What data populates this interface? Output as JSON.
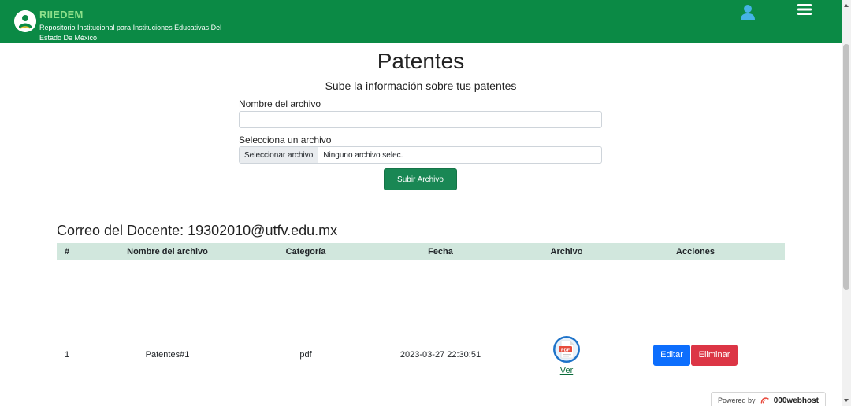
{
  "navbar": {
    "brand_title": "RIIEDEM",
    "brand_subtitle": "Repositorio Institucional para Instituciones Educativas Del Estado De México",
    "user_icon": "user-icon",
    "menu_icon": "hamburger-menu-icon",
    "background_color": "#0b8a45"
  },
  "upload": {
    "title": "Patentes",
    "subtitle": "Sube la información sobre tus patentes",
    "name_label": "Nombre del archivo",
    "name_value": "",
    "file_label": "Selecciona un archivo",
    "file_button": "Seleccionar archivo",
    "file_status": "Ninguno archivo selec.",
    "submit_label": "Subir Archivo"
  },
  "records": {
    "heading": "Correo del Docente: 19302010@utfv.edu.mx",
    "columns": [
      "#",
      "Nombre del archivo",
      "Categoría",
      "Fecha",
      "Archivo",
      "Acciones"
    ],
    "rows": [
      {
        "num": "1",
        "name": "Patentes#1",
        "category": "pdf",
        "date": "2023-03-27 22:30:51",
        "file_icon": "pdf-file-icon",
        "file_link": "Ver",
        "edit_label": "Editar",
        "delete_label": "Eliminar"
      }
    ]
  },
  "footer_badge": {
    "powered": "Powered by",
    "brand": "000webhost"
  },
  "colors": {
    "primary_green": "#198754",
    "table_header": "#d1e7dd",
    "edit": "#0d6efd",
    "delete": "#dc3545"
  }
}
